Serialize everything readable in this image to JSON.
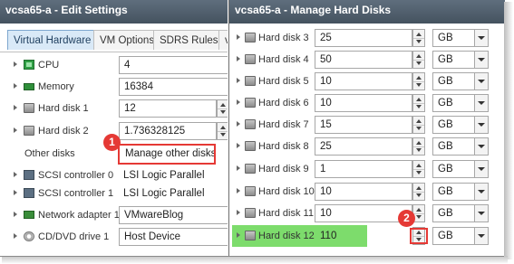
{
  "left_dialog": {
    "title": "vcsa65-a - Edit Settings",
    "tabs": [
      "Virtual Hardware",
      "VM Options",
      "SDRS Rules",
      "v"
    ],
    "rows": [
      {
        "label": "CPU",
        "icon": "cpu-icon",
        "value": "4",
        "control": "select"
      },
      {
        "label": "Memory",
        "icon": "memory-icon",
        "value": "16384",
        "control": "select"
      },
      {
        "label": "Hard disk 1",
        "icon": "hard-disk-icon",
        "value": "12",
        "control": "spinner"
      },
      {
        "label": "Hard disk 2",
        "icon": "hard-disk-icon",
        "value": "1.736328125",
        "control": "spinner"
      },
      {
        "label": "Other disks",
        "value": "Manage other disks",
        "control": "button"
      },
      {
        "label": "SCSI controller 0",
        "icon": "scsi-controller-icon",
        "value": "LSI Logic Parallel",
        "control": "text"
      },
      {
        "label": "SCSI controller 1",
        "icon": "scsi-controller-icon",
        "value": "LSI Logic Parallel",
        "control": "text"
      },
      {
        "label": "Network adapter 1",
        "icon": "network-adapter-icon",
        "value": "VMwareBlog",
        "control": "select"
      },
      {
        "label": "CD/DVD drive 1",
        "icon": "cd-dvd-icon",
        "value": "Host Device",
        "control": "select"
      }
    ]
  },
  "right_dialog": {
    "title": "vcsa65-a - Manage Hard Disks",
    "disks": [
      {
        "label": "Hard disk 3",
        "size": "25",
        "unit": "GB"
      },
      {
        "label": "Hard disk 4",
        "size": "50",
        "unit": "GB"
      },
      {
        "label": "Hard disk 5",
        "size": "10",
        "unit": "GB"
      },
      {
        "label": "Hard disk 6",
        "size": "10",
        "unit": "GB"
      },
      {
        "label": "Hard disk 7",
        "size": "15",
        "unit": "GB"
      },
      {
        "label": "Hard disk 8",
        "size": "25",
        "unit": "GB"
      },
      {
        "label": "Hard disk 9",
        "size": "1",
        "unit": "GB"
      },
      {
        "label": "Hard disk 10",
        "size": "10",
        "unit": "GB"
      },
      {
        "label": "Hard disk 11",
        "size": "10",
        "unit": "GB"
      },
      {
        "label": "Hard disk 12",
        "size": "110",
        "unit": "GB",
        "highlighted": true
      }
    ]
  },
  "annotations": {
    "step1": "1",
    "step2": "2",
    "color": "#e53935",
    "highlight_color": "#7ddc6c"
  }
}
